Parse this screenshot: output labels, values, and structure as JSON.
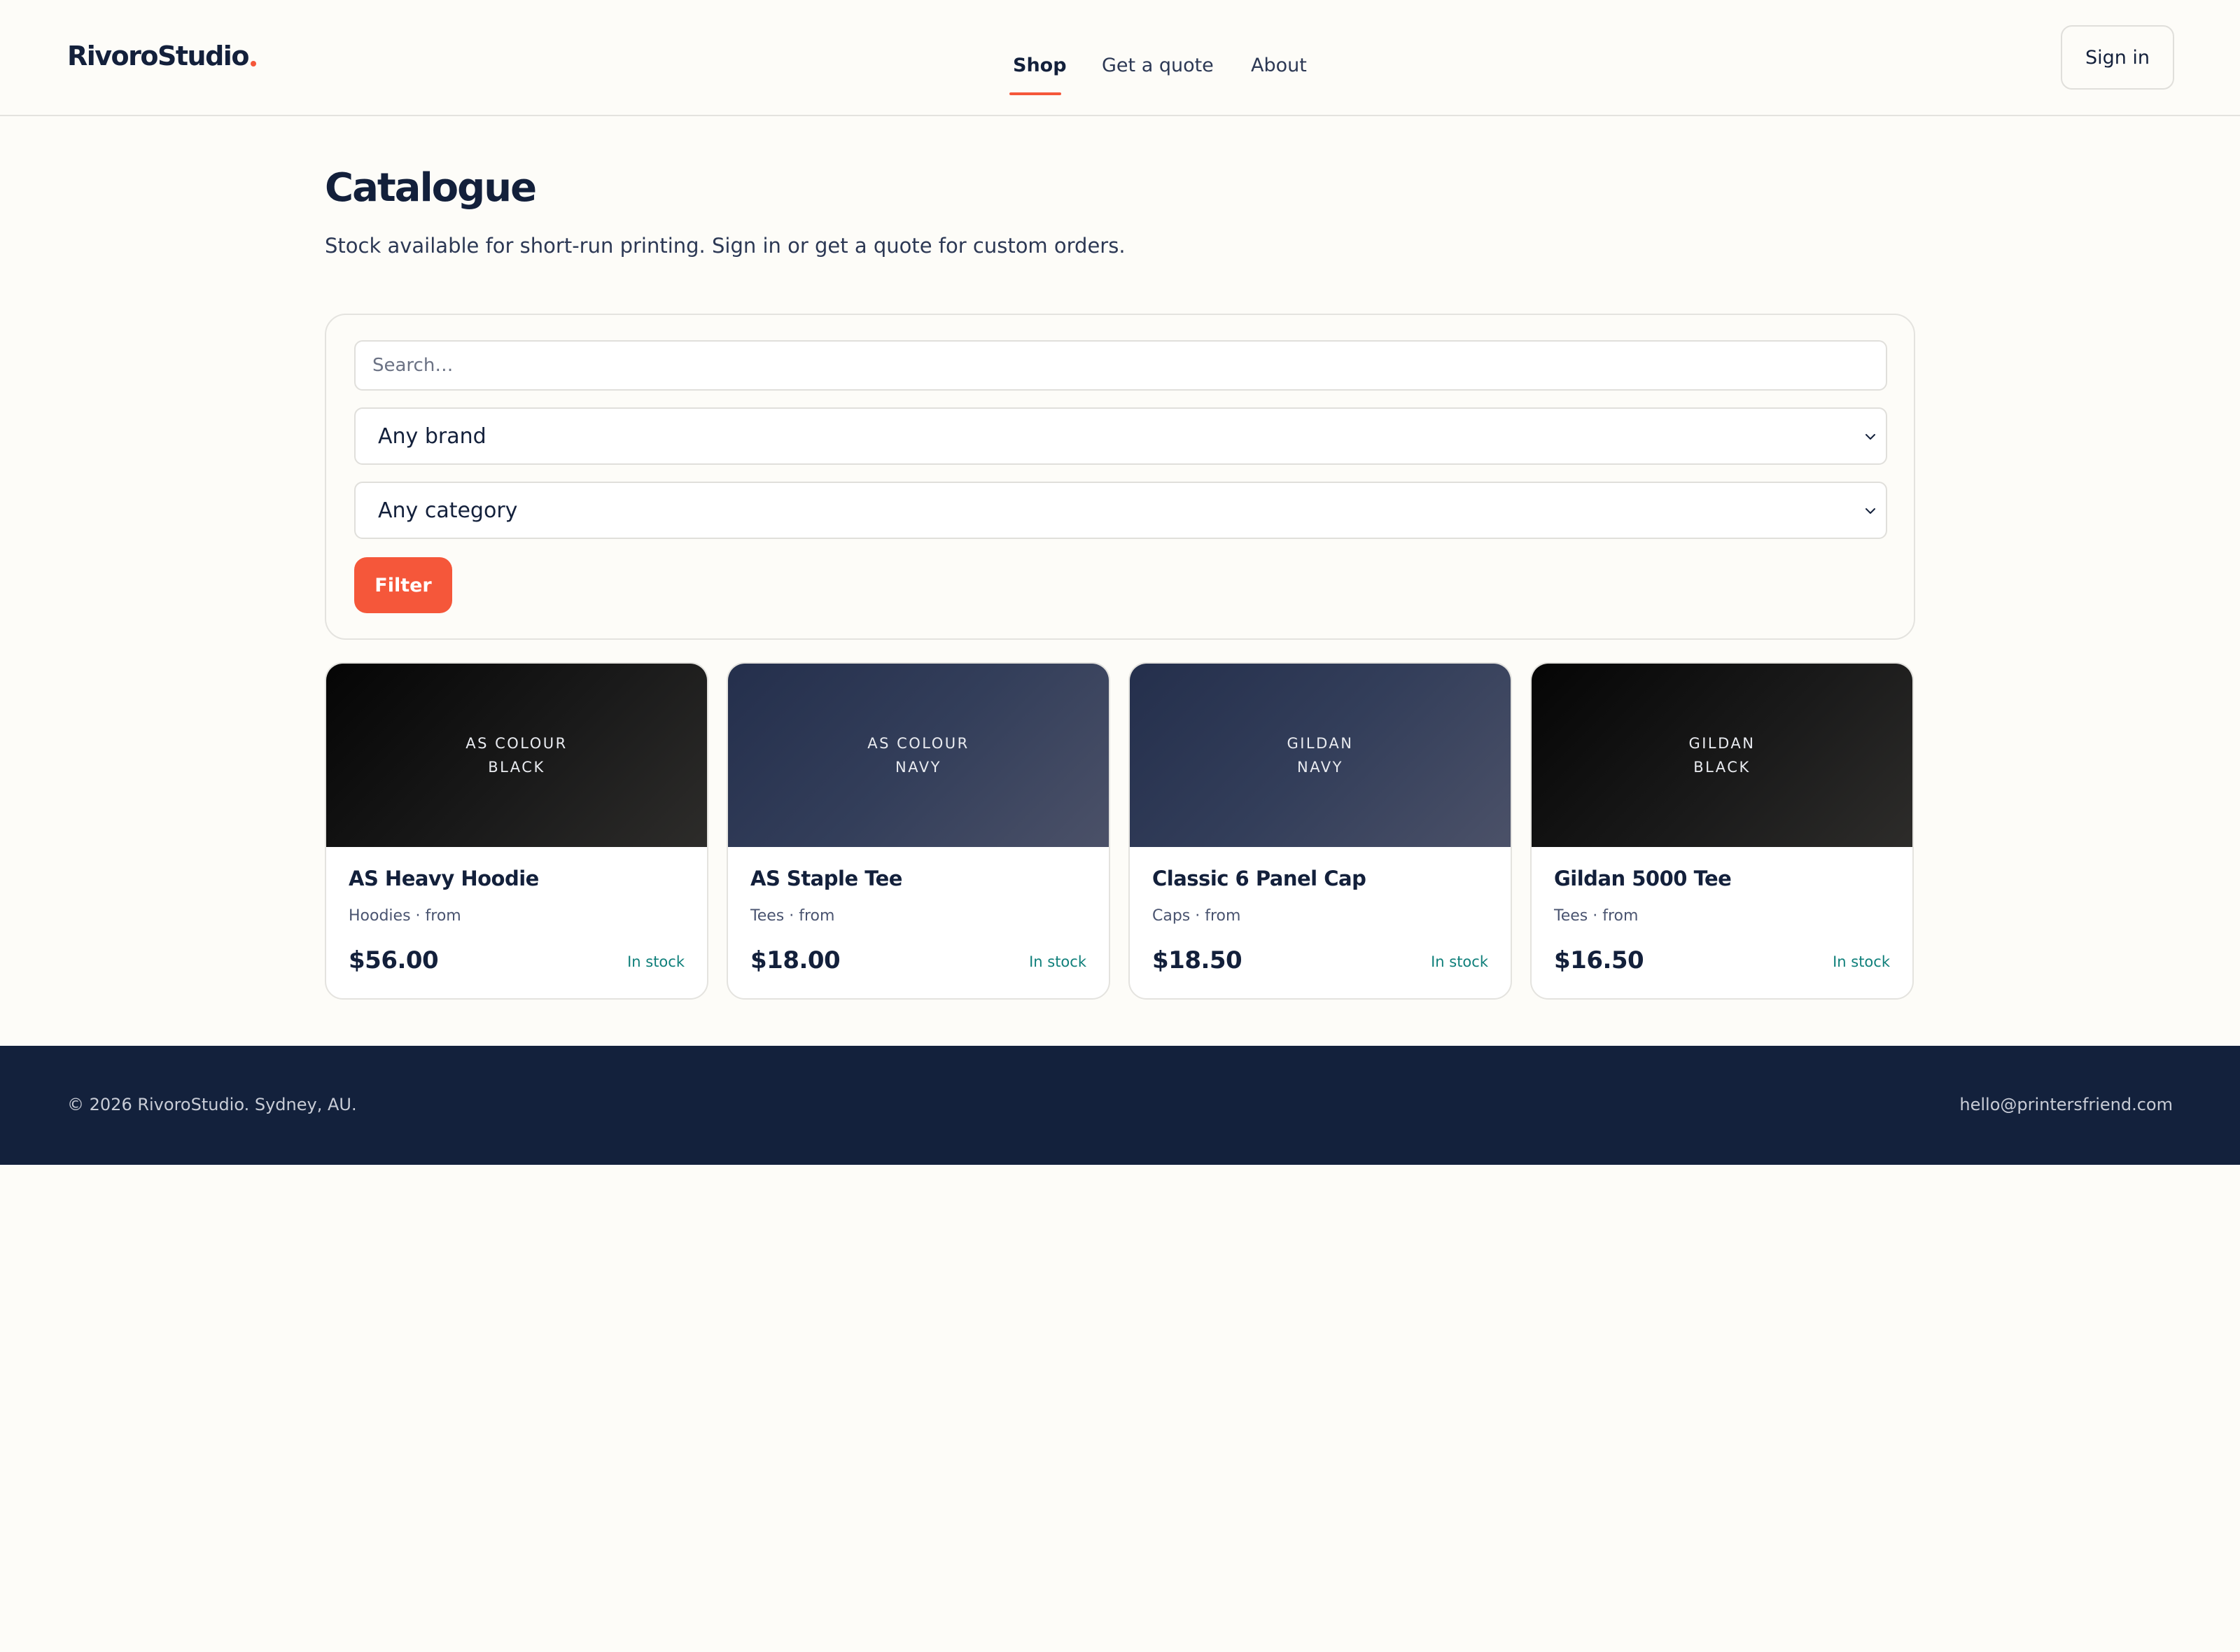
{
  "header": {
    "brand": "RivoroStudio",
    "nav": [
      {
        "label": "Shop",
        "active": true
      },
      {
        "label": "Get a quote",
        "active": false
      },
      {
        "label": "About",
        "active": false
      }
    ],
    "signin_label": "Sign in"
  },
  "page": {
    "title": "Catalogue",
    "subtitle": "Stock available for short-run printing. Sign in or get a quote for custom orders."
  },
  "filters": {
    "search_placeholder": "Search…",
    "brand_value": "Any brand",
    "category_value": "Any category",
    "filter_label": "Filter"
  },
  "products": [
    {
      "brand": "AS COLOUR",
      "colour": "BLACK",
      "name": "AS Heavy Hoodie",
      "meta": "Hoodies · from",
      "price": "$56.00",
      "stock": "In stock"
    },
    {
      "brand": "AS COLOUR",
      "colour": "NAVY",
      "name": "AS Staple Tee",
      "meta": "Tees · from",
      "price": "$18.00",
      "stock": "In stock"
    },
    {
      "brand": "GILDAN",
      "colour": "NAVY",
      "name": "Classic 6 Panel Cap",
      "meta": "Caps · from",
      "price": "$18.50",
      "stock": "In stock"
    },
    {
      "brand": "GILDAN",
      "colour": "BLACK",
      "name": "Gildan 5000 Tee",
      "meta": "Tees · from",
      "price": "$16.50",
      "stock": "In stock"
    }
  ],
  "footer": {
    "copyright": "© 2026 RivoroStudio. Sydney, AU.",
    "email": "hello@printersfriend.com"
  },
  "colors": {
    "accent": "#f5573a",
    "navy": "#13213c",
    "stock": "#0f7f7a",
    "background": "#fdfcf8"
  }
}
